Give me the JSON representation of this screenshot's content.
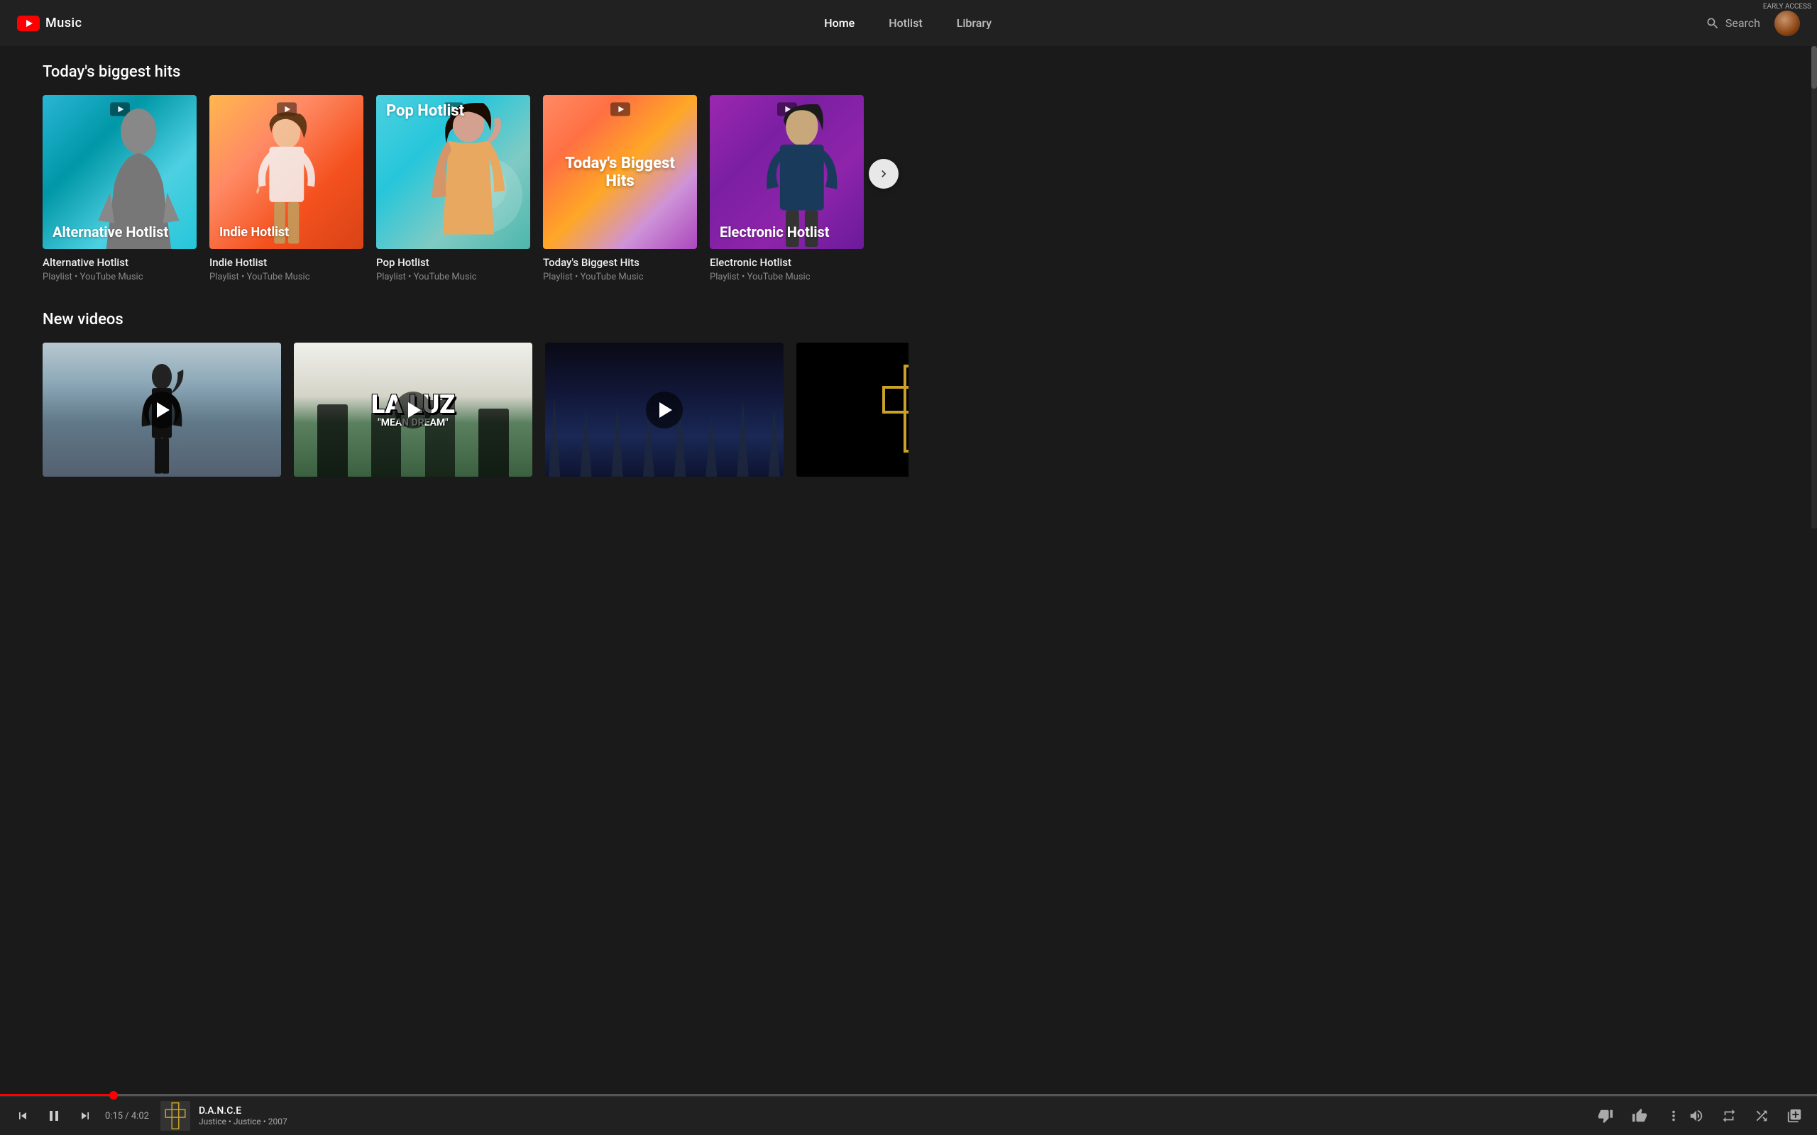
{
  "header": {
    "logo_text": "Music",
    "nav": [
      {
        "id": "home",
        "label": "Home",
        "active": true
      },
      {
        "id": "hotlist",
        "label": "Hotlist",
        "active": false
      },
      {
        "id": "library",
        "label": "Library",
        "active": false
      }
    ],
    "search_placeholder": "Search",
    "early_access": "EARLY ACCESS"
  },
  "biggest_hits_section": {
    "title": "Today's biggest hits",
    "cards": [
      {
        "id": "alt-hotlist",
        "thumb_label": "Alternative Hotlist",
        "card_title": "Alternative Hotlist",
        "subtitle": "Playlist • YouTube Music",
        "theme": "alt"
      },
      {
        "id": "indie-hotlist",
        "thumb_label": "Indie Hotlist",
        "card_title": "Indie Hotlist",
        "subtitle": "Playlist • YouTube Music",
        "theme": "indie"
      },
      {
        "id": "pop-hotlist",
        "thumb_label": "Pop Hotlist",
        "card_title": "Pop Hotlist",
        "subtitle": "Playlist • YouTube Music",
        "theme": "pop"
      },
      {
        "id": "biggest-hits",
        "thumb_label": "Today's Biggest Hits",
        "card_title": "Today's Biggest Hits",
        "subtitle": "Playlist • YouTube Music",
        "theme": "biggest"
      },
      {
        "id": "electronic-hotlist",
        "thumb_label": "Electronic Hotlist",
        "card_title": "Electronic Hotlist",
        "subtitle": "Playlist • YouTube Music",
        "theme": "electronic"
      }
    ]
  },
  "new_videos_section": {
    "title": "New videos",
    "videos": [
      {
        "id": "vid-1",
        "theme": "ocean",
        "title": "",
        "artist": ""
      },
      {
        "id": "vid-2",
        "theme": "laluz",
        "band_name": "LA LUZ",
        "album_name": "\"MEAN DREAM\"",
        "title": "",
        "artist": ""
      },
      {
        "id": "vid-3",
        "theme": "dark",
        "title": "",
        "artist": ""
      },
      {
        "id": "vid-4",
        "theme": "justice",
        "title": "",
        "artist": ""
      }
    ]
  },
  "player": {
    "progress_percent": 6.25,
    "time_current": "0:15",
    "time_total": "4:02",
    "time_display": "0:15 / 4:02",
    "track_title": "D.A.N.C.E",
    "track_artist": "Justice • Justice • 2007",
    "controls": {
      "prev": "previous",
      "play_pause": "pause",
      "next": "next"
    },
    "actions": {
      "dislike": "thumbs-down",
      "like": "thumbs-up",
      "more": "more-options"
    },
    "right_controls": {
      "volume": "volume",
      "repeat": "repeat",
      "shuffle": "shuffle",
      "queue": "queue"
    }
  }
}
